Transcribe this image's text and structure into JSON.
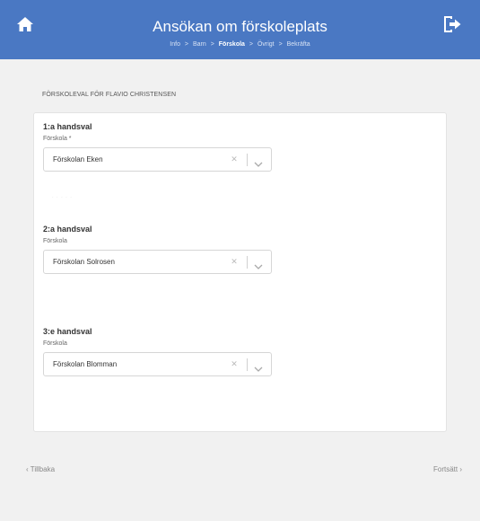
{
  "header": {
    "title": "Ansökan om förskoleplats",
    "icons": {
      "home": "home-icon",
      "logout": "logout-icon"
    },
    "bg_color": "#4a78c3"
  },
  "breadcrumb": {
    "steps": [
      "Info",
      "Barn",
      "Förskola",
      "Övrigt",
      "Bekräfta"
    ],
    "separator": ">",
    "active_step": "Förskola"
  },
  "section": {
    "title": "FÖRSKOLEVAL FÖR FLAVIO CHRISTENSEN"
  },
  "choices": [
    {
      "heading": "1:a handsval",
      "label": "Förskola *",
      "value": "Förskolan Eken"
    },
    {
      "heading": "2:a handsval",
      "label": "Förskola",
      "value": "Förskolan Solrosen"
    },
    {
      "heading": "3:e handsval",
      "label": "Förskola",
      "value": "Förskolan Blomman"
    }
  ],
  "footer": {
    "back_label": "‹ Tillbaka",
    "next_label": "Fortsätt ›"
  }
}
